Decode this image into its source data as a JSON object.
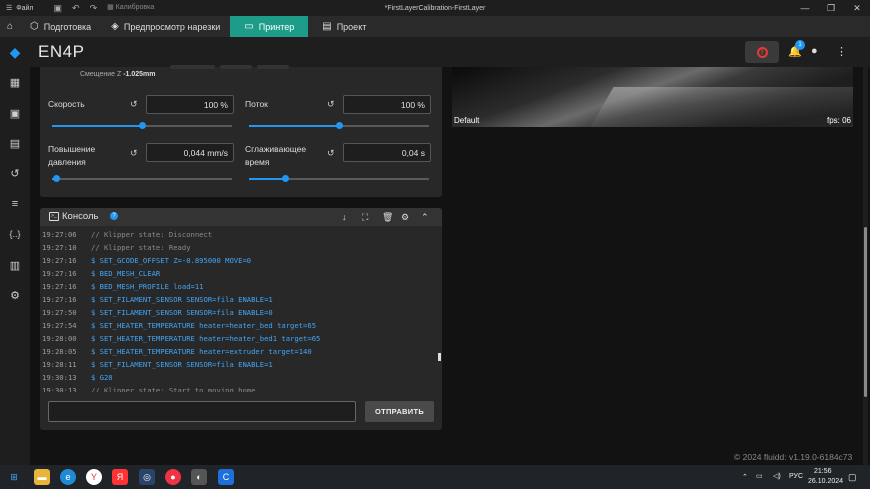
{
  "window": {
    "file_label": "Файл",
    "calibration_label": "Калибровка",
    "title": "*FirstLayerCalibration-FirstLayer"
  },
  "tabs": [
    {
      "label": "Подготовка",
      "icon": "cube-icon"
    },
    {
      "label": "Предпросмотр нарезки",
      "icon": "layers-icon"
    },
    {
      "label": "Принтер",
      "icon": "monitor-icon"
    },
    {
      "label": "Проект",
      "icon": "project-icon"
    }
  ],
  "header": {
    "logo": "EN4P",
    "notification_count": "1"
  },
  "tune": {
    "offset_label": "Смещение Z",
    "offset_value": "-1.025mm",
    "speed_label": "Скорость",
    "speed_value": "100 %",
    "speed_fraction": 0.5,
    "flow_label": "Поток",
    "flow_value": "100 %",
    "flow_fraction": 0.5,
    "pa_label": "Повышение давления",
    "pa_value": "0,044 mm/s",
    "pa_fraction": 0.02,
    "smooth_label": "Сглаживающее время",
    "smooth_value": "0,04 s",
    "smooth_fraction": 0.2
  },
  "camera": {
    "name": "Default",
    "fps": "fps: 06"
  },
  "console": {
    "title": "Консоль",
    "send_label": "ОТПРАВИТЬ",
    "input_value": "",
    "log": [
      {
        "time": "19:27:06",
        "text": "// Klipper state: Disconnect",
        "kind": "resp"
      },
      {
        "time": "19:27:10",
        "text": "// Klipper state: Ready",
        "kind": "resp"
      },
      {
        "time": "19:27:16",
        "text": "$ SET_GCODE_OFFSET Z=-0.895000 MOVE=0",
        "kind": "cmd"
      },
      {
        "time": "19:27:16",
        "text": "$ BED_MESH_CLEAR",
        "kind": "cmd"
      },
      {
        "time": "19:27:16",
        "text": "$ BED_MESH_PROFILE load=11",
        "kind": "cmd"
      },
      {
        "time": "19:27:16",
        "text": "$ SET_FILAMENT_SENSOR SENSOR=fila ENABLE=1",
        "kind": "cmd"
      },
      {
        "time": "19:27:50",
        "text": "$ SET_FILAMENT_SENSOR SENSOR=fila ENABLE=0",
        "kind": "cmd"
      },
      {
        "time": "19:27:54",
        "text": "$ SET_HEATER_TEMPERATURE heater=heater_bed target=65",
        "kind": "cmd"
      },
      {
        "time": "19:28:00",
        "text": "$ SET_HEATER_TEMPERATURE heater=heater_bed1 target=65",
        "kind": "cmd"
      },
      {
        "time": "19:28:05",
        "text": "$ SET_HEATER_TEMPERATURE heater=extruder target=140",
        "kind": "cmd"
      },
      {
        "time": "19:28:11",
        "text": "$ SET_FILAMENT_SENSOR SENSOR=fila ENABLE=1",
        "kind": "cmd"
      },
      {
        "time": "19:30:13",
        "text": "$ G28",
        "kind": "cmd"
      },
      {
        "time": "19:30:13",
        "text": "// Klipper state: Start to moving home",
        "kind": "resp"
      }
    ]
  },
  "footer": "© 2024 fluidd: v1.19.0-6184c73",
  "taskbar": {
    "lang": "РУС",
    "time": "21:56",
    "date": "26.10.2024"
  },
  "colors": {
    "accent": "#2196f3",
    "active_tab": "#1e9c8a",
    "emergency": "#e53935"
  }
}
